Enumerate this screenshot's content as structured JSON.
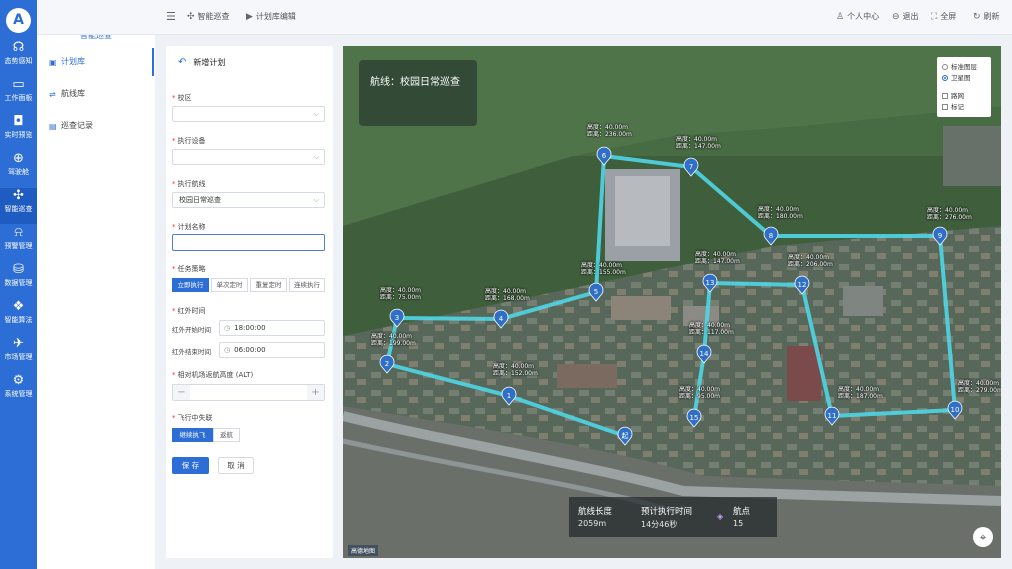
{
  "rail": {
    "logo": "A",
    "items": [
      {
        "icon": "headset-icon",
        "glyph": "☊",
        "label": "态势感知"
      },
      {
        "icon": "monitor-icon",
        "glyph": "▭",
        "label": "工作面板"
      },
      {
        "icon": "camera-icon",
        "glyph": "◘",
        "label": "实时预览"
      },
      {
        "icon": "globe-icon",
        "glyph": "⊕",
        "label": "驾驶舱"
      },
      {
        "icon": "drone-icon",
        "glyph": "✣",
        "label": "智能巡查"
      },
      {
        "icon": "alarm-icon",
        "glyph": "⍾",
        "label": "预警管理"
      },
      {
        "icon": "database-icon",
        "glyph": "⛁",
        "label": "数据管理"
      },
      {
        "icon": "algorithm-icon",
        "glyph": "❖",
        "label": "智能算法"
      },
      {
        "icon": "airplane-icon",
        "glyph": "✈",
        "label": "市场管理"
      },
      {
        "icon": "gear-icon",
        "glyph": "⚙",
        "label": "系统管理"
      }
    ]
  },
  "topbar": {
    "menu_glyph": "☰",
    "crumb1": "智能巡查",
    "crumb2": "计划库编辑",
    "personal": "个人中心",
    "logout": "退出",
    "fullscreen": "全屏",
    "refresh": "刷新"
  },
  "sidebar": {
    "title": "智能巡查",
    "items": [
      {
        "label": "计划库",
        "glyph": "▣"
      },
      {
        "label": "航线库",
        "glyph": "⇌"
      },
      {
        "label": "巡查记录",
        "glyph": "▤"
      }
    ]
  },
  "form": {
    "header": "新增计划",
    "campus_label": "校区",
    "campus_value": "",
    "device_label": "执行设备",
    "device_value": "",
    "route_label": "执行航线",
    "route_value": "校园日常巡查",
    "name_label": "计划名称",
    "name_value": "",
    "strategy_label": "任务策略",
    "strategy_options": [
      "立即执行",
      "单次定时",
      "重复定时",
      "连续执行"
    ],
    "infrared_label": "红外时间",
    "ir_start_label": "红外开始时间",
    "ir_start_value": "18:00:00",
    "ir_end_label": "红外结束时间",
    "ir_end_value": "06:00:00",
    "alt_label": "相对机场返航高度 (ALT)",
    "alt_value": "",
    "lost_label": "飞行中失联",
    "lost_options": [
      "继续执飞",
      "返航"
    ],
    "save": "保 存",
    "cancel": "取 消"
  },
  "map": {
    "route_title": "航线：校园日常巡查",
    "layers": {
      "standard": "标准图层",
      "satellite": "卫星图",
      "roadnet": "路网",
      "marker": "标记",
      "active": "satellite"
    },
    "route_color": "#4fd6e6",
    "waypoints": [
      {
        "n": "1",
        "alt": "高度：40.00m",
        "dist": "距离：152.00m"
      },
      {
        "n": "2",
        "alt": "高度：40.00m",
        "dist": "距离：199.00m"
      },
      {
        "n": "3",
        "alt": "高度：40.00m",
        "dist": "距离：75.00m"
      },
      {
        "n": "4",
        "alt": "高度：40.00m",
        "dist": "距离：168.00m"
      },
      {
        "n": "5",
        "alt": "高度：40.00m",
        "dist": "距离：155.00m"
      },
      {
        "n": "6",
        "alt": "高度：40.00m",
        "dist": "距离：236.00m"
      },
      {
        "n": "7",
        "alt": "高度：40.00m",
        "dist": "距离：147.00m"
      },
      {
        "n": "8",
        "alt": "高度：40.00m",
        "dist": "距离：180.00m"
      },
      {
        "n": "9",
        "alt": "高度：40.00m",
        "dist": "距离：276.00m"
      },
      {
        "n": "10",
        "alt": "高度：40.00m",
        "dist": "距离：279.00m"
      },
      {
        "n": "11",
        "alt": "高度：40.00m",
        "dist": "距离：187.00m"
      },
      {
        "n": "12",
        "alt": "高度：40.00m",
        "dist": "距离：206.00m"
      },
      {
        "n": "13",
        "alt": "高度：40.00m",
        "dist": "距离：147.00m"
      },
      {
        "n": "14",
        "alt": "高度：40.00m",
        "dist": "距离：117.00m"
      },
      {
        "n": "15",
        "alt": "高度：40.00m",
        "dist": "距离：95.00m"
      }
    ],
    "start_label": "起",
    "stats": {
      "length_label": "航线长度",
      "length_value": "2059m",
      "time_label": "预计执行时间",
      "time_value": "14分46秒",
      "points_label": "航点",
      "points_value": "15"
    },
    "tag": "高德地图"
  }
}
